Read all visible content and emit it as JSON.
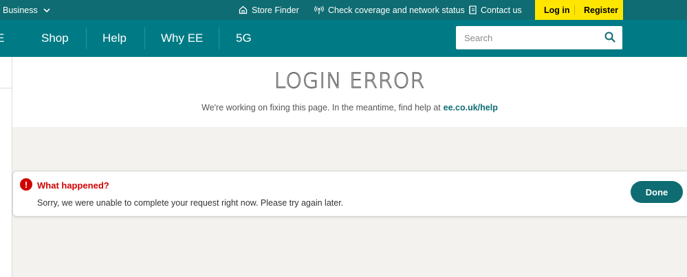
{
  "topbar": {
    "business_label": "Business",
    "store_finder": "Store Finder",
    "coverage": "Check coverage and network status",
    "contact": "Contact us",
    "login": "Log in",
    "register": "Register"
  },
  "nav": {
    "brand_fragment": "E",
    "items": [
      "Shop",
      "Help",
      "Why EE",
      "5G"
    ]
  },
  "search": {
    "placeholder": "Search"
  },
  "hero": {
    "title": "LOGIN ERROR",
    "subtitle": "We're working on fixing this page. In the meantime, find help at",
    "help_link": "ee.co.uk/help"
  },
  "alert": {
    "heading": "What happened?",
    "message": "Sorry, we were unable to complete your request right now. Please try again later.",
    "done_label": "Done"
  },
  "icons": {
    "chevron": "chevron-down-icon",
    "store": "store-icon",
    "signal": "signal-icon",
    "contact": "contact-icon",
    "search": "search-icon",
    "error": "error-icon"
  },
  "colors": {
    "topbar": "#0e6c72",
    "navbar": "#007b85",
    "accent_yellow": "#ffe600",
    "error_red": "#d10000",
    "button": "#0e6c72"
  }
}
